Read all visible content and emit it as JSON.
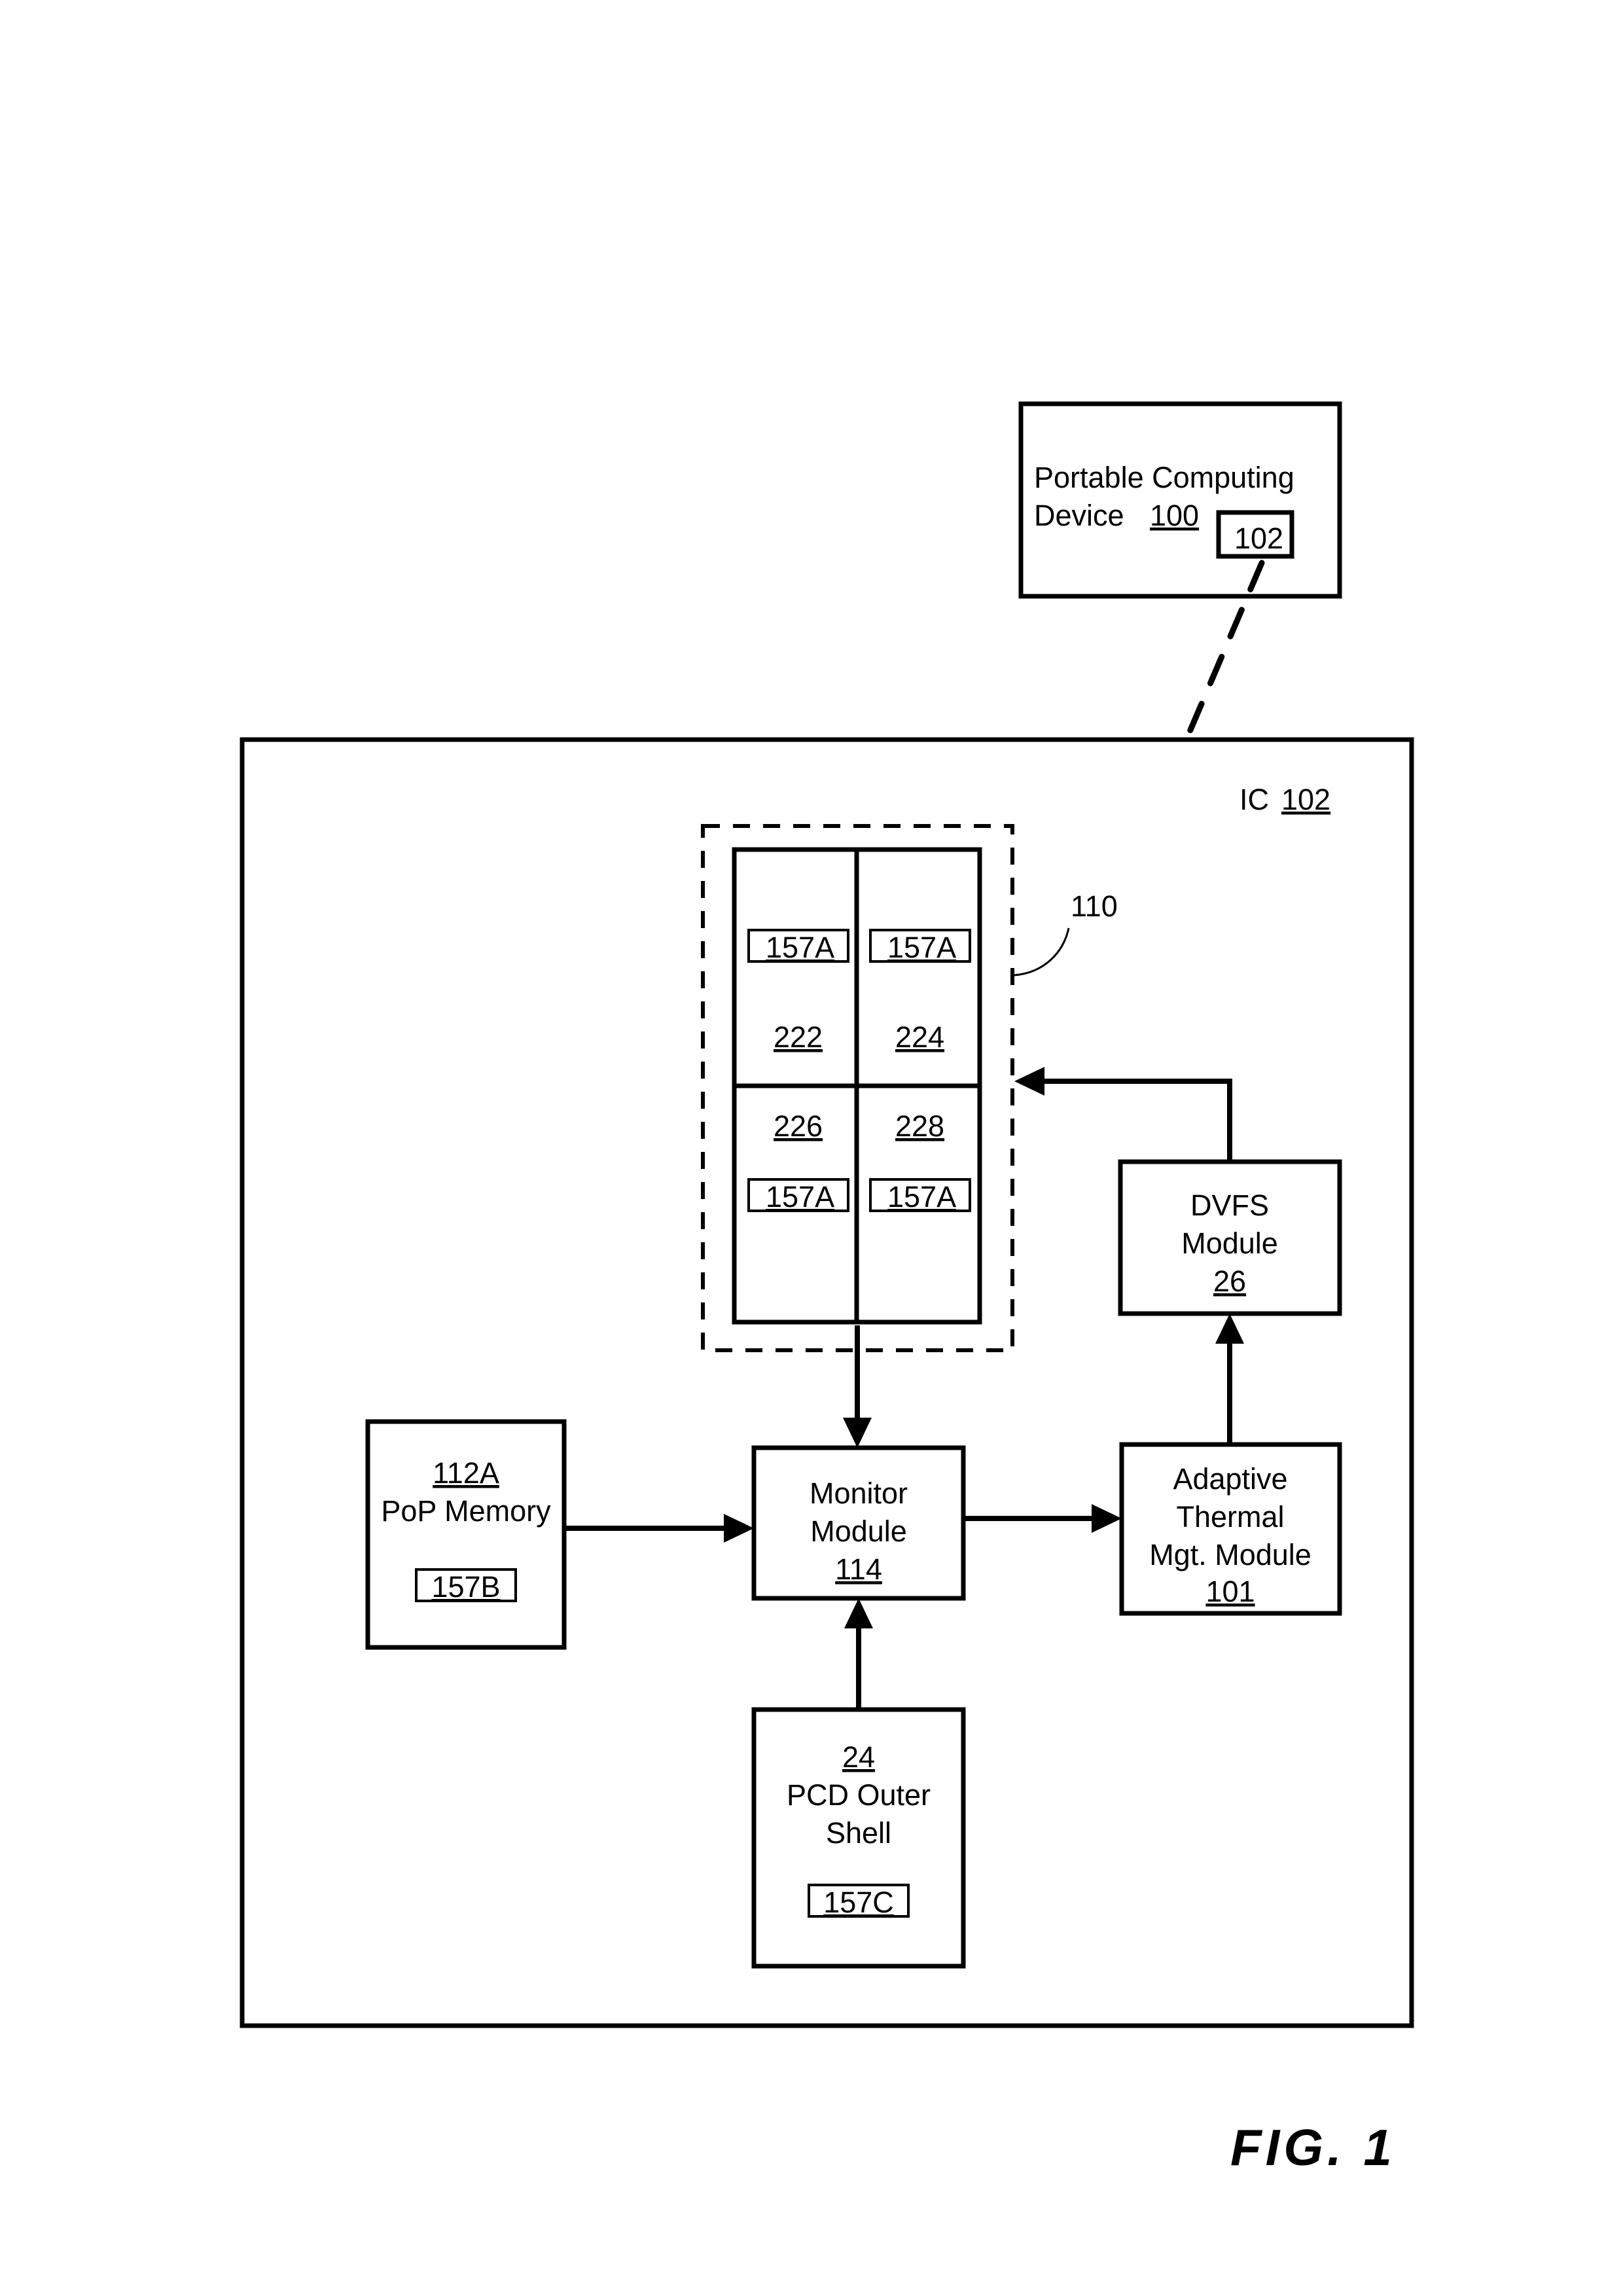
{
  "figure": {
    "caption": "FIG.  1"
  },
  "pcd": {
    "title_line1": "Portable Computing",
    "title_line2": "Device",
    "ref": "100",
    "inner_ref": "102"
  },
  "ic": {
    "label_prefix": "IC",
    "ref": "102"
  },
  "cluster": {
    "ref": "110",
    "cores": [
      {
        "position": "top-left",
        "ref": "222",
        "sensor": "157A"
      },
      {
        "position": "top-right",
        "ref": "224",
        "sensor": "157A"
      },
      {
        "position": "bottom-left",
        "ref": "226",
        "sensor": "157A"
      },
      {
        "position": "bottom-right",
        "ref": "228",
        "sensor": "157A"
      }
    ]
  },
  "dvfs_module": {
    "line1": "DVFS",
    "line2": "Module",
    "ref": "26"
  },
  "pop_memory": {
    "ref": "112A",
    "name": "PoP Memory",
    "sensor": "157B"
  },
  "monitor_module": {
    "line1": "Monitor",
    "line2": "Module",
    "ref": "114"
  },
  "adaptive_thermal_module": {
    "line1": "Adaptive",
    "line2": "Thermal",
    "line3": "Mgt. Module",
    "ref": "101"
  },
  "pcd_outer_shell": {
    "ref": "24",
    "line1": "PCD Outer",
    "line2": "Shell",
    "sensor": "157C"
  },
  "colors": {
    "ink": "#000000",
    "paper": "#ffffff"
  }
}
